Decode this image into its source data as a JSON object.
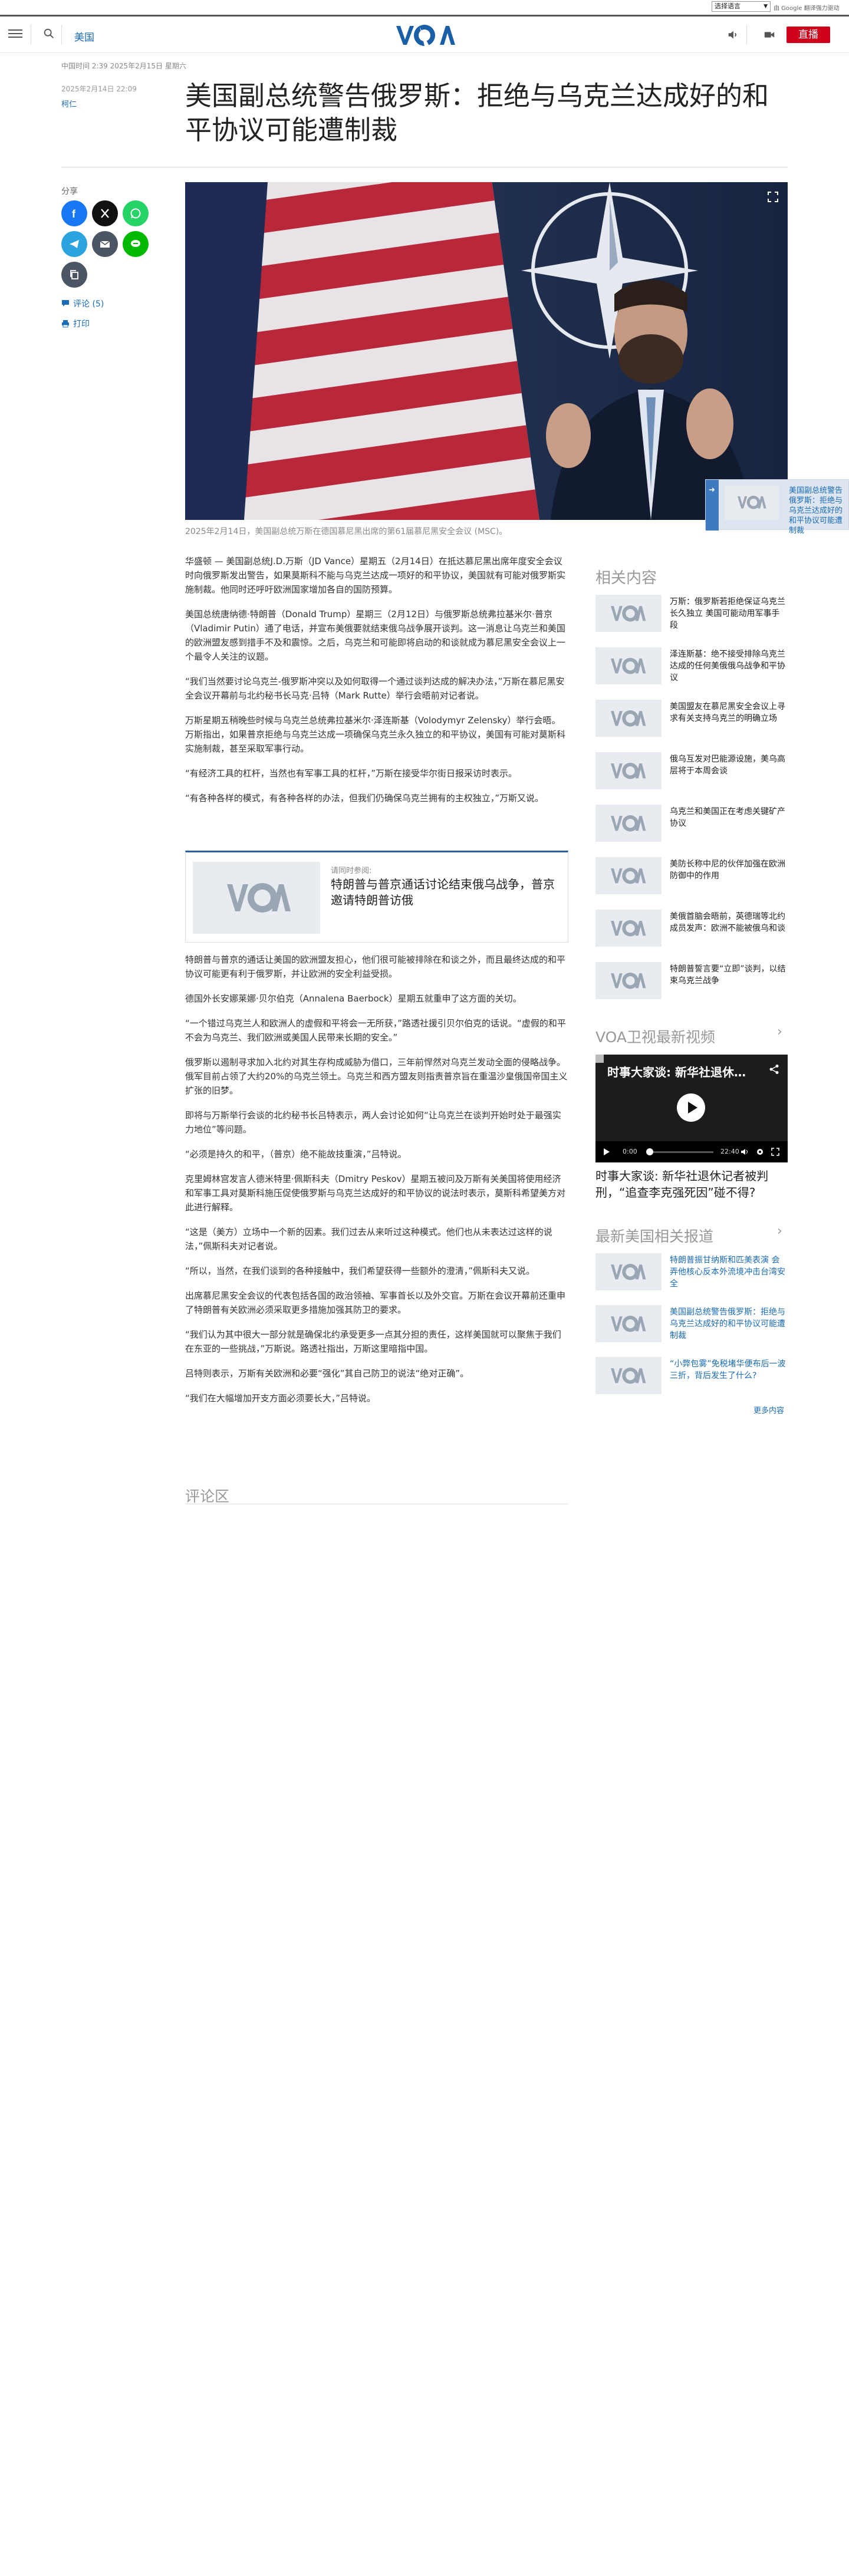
{
  "translate_bar": {
    "select_label": "选择语言",
    "powered_by": "由 Google 翻译强力驱动"
  },
  "header": {
    "section": "美国",
    "live_label": "直播",
    "logo_text": "VOA"
  },
  "article": {
    "dateline": "中国时间 2:39 2025年2月15日 星期六",
    "published": "2025年2月14日 22:09",
    "author": "柯仁",
    "title": "美国副总统警告俄罗斯：拒绝与乌克兰达成好的和平协议可能遭制裁",
    "caption": "2025年2月14日，美国副总统万斯在德国慕尼黑出席的第61届慕尼黑安全会议 (MSC)。",
    "share_label": "分享",
    "comments_label": "评论 (5)",
    "print_label": "打印",
    "paragraphs_top": [
      "华盛顿 — 美国副总统J.D.万斯（JD Vance）星期五（2月14日）在抵达慕尼黑出席年度安全会议时向俄罗斯发出警告，如果莫斯科不能与乌克兰达成一项好的和平协议，美国就有可能对俄罗斯实施制裁。他同时还呼吁欧洲国家增加各自的国防预算。",
      "美国总统唐纳德·特朗普（Donald Trump）星期三（2月12日）与俄罗斯总统弗拉基米尔·普京（Vladimir Putin）通了电话，并宣布美俄要就结束俄乌战争展开谈判。这一消息让乌克兰和美国的欧洲盟友感到措手不及和震惊。之后，乌克兰和可能即将启动的和谈就成为慕尼黑安全会议上一个最令人关注的议题。",
      "“我们当然要讨论乌克兰-俄罗斯冲突以及如何取得一个通过谈判达成的解决办法，”万斯在慕尼黑安全会议开幕前与北约秘书长马克·吕特（Mark Rutte）举行会晤前对记者说。",
      "万斯星期五稍晚些时候与乌克兰总统弗拉基米尔·泽连斯基（Volodymyr Zelensky）举行会晤。万斯指出，如果普京拒绝与乌克兰达成一项确保乌克兰永久独立的和平协议，美国有可能对莫斯科实施制裁，甚至采取军事行动。",
      "“有经济工具的杠杆，当然也有军事工具的杠杆，”万斯在接受华尔街日报采访时表示。",
      "“有各种各样的模式，有各种各样的办法，但我们仍确保乌克兰拥有的主权独立，”万斯又说。"
    ],
    "related": {
      "kicker": "请同时参阅:",
      "title": "特朗普与普京通话讨论结束俄乌战争，普京邀请特朗普访俄"
    },
    "paragraphs_bottom": [
      "特朗普与普京的通话让美国的欧洲盟友担心，他们很可能被排除在和谈之外，而且最终达成的和平协议可能更有利于俄罗斯，并让欧洲的安全利益受损。",
      "德国外长安娜莱娜·贝尔伯克（Annalena Baerbock）星期五就重申了这方面的关切。",
      "“一个错过乌克兰人和欧洲人的虚假和平将会一无所获，”路透社援引贝尔伯克的话说。“虚假的和平不会为乌克兰、我们欧洲或美国人民带来长期的安全。”",
      "俄罗斯以遏制寻求加入北约对其生存构成威胁为借口，三年前悍然对乌克兰发动全面的侵略战争。俄军目前占领了大约20%的乌克兰领土。乌克兰和西方盟友则指责普京旨在重温沙皇俄国帝国主义扩张的旧梦。",
      "即将与万斯举行会谈的北约秘书长吕特表示，两人会讨论如何“让乌克兰在谈判开始时处于最强实力地位”等问题。",
      "“必须是持久的和平，（普京）绝不能故技重演，”吕特说。",
      "克里姆林宫发言人德米特里·佩斯科夫（Dmitry Peskov）星期五被问及万斯有关美国将使用经济和军事工具对莫斯科施压促使俄罗斯与乌克兰达成好的和平协议的说法时表示，莫斯科希望美方对此进行解释。",
      "“这是（美方）立场中一个新的因素。我们过去从来听过这种模式。他们也从未表达过这样的说法，”佩斯科夫对记者说。",
      "“所以，当然，在我们谈到的各种接触中，我们希望获得一些额外的澄清，”佩斯科夫又说。",
      "出席慕尼黑安全会议的代表包括各国的政治领袖、军事首长以及外交官。万斯在会议开幕前还重申了特朗普有关欧洲必须采取更多措施加强其防卫的要求。",
      "“我们认为其中很大一部分就是确保北约承受更多一点其分担的责任，这样美国就可以聚焦于我们在东亚的一些挑战，”万斯说。路透社指出，万斯这里暗指中国。",
      "吕特则表示，万斯有关欧洲和必要“强化”其自己防卫的说法“绝对正确”。",
      "“我们在大幅增加开支方面必须要长大，”吕特说。"
    ],
    "comments_heading": "评论区"
  },
  "rail": {
    "related_heading": "相关内容",
    "related_items": [
      "万斯：俄罗斯若拒绝保证乌克兰长久独立 美国可能动用军事手段",
      "泽连斯基：绝不接受排除乌克兰达成的任何美俄俄乌战争和平协议",
      "美国盟友在慕尼黑安全会议上寻求有关支持乌克兰的明确立场",
      "俄乌互发对巴能源设施，美乌高层将于本周会谈",
      "乌克兰和美国正在考虑关键矿产协议",
      "美防长称中尼的伙伴加强在欧洲防御中的作用",
      "美俄首脑会晤前，英德瑞等北约成员发声：欧洲不能被俄乌和谈",
      "特朗普誓言要“立即”谈判，以结束乌克兰战争"
    ],
    "video_heading": "VOA卫视最新视频",
    "video": {
      "overlay_title": "时事大家谈: 新华社退休记...",
      "time_current": "0:00",
      "time_total": "22:40",
      "progress_fraction": 0.0,
      "caption": "时事大家谈: 新华社退休记者被判刑，“追查李克强死因”碰不得?"
    },
    "latest_heading": "最新美国相关报道",
    "latest_items": [
      "特朗普振甘纳斯和匹美表演 会弄他核心反本外流境冲击台湾安全",
      "美国副总统警告俄罗斯：拒绝与乌克兰达成好的和平协议可能遭制裁",
      "“小弊包雾”免税堵华便布后一波三折，背后发生了什么?"
    ],
    "more_label": "更多内容"
  },
  "floating": {
    "text": "美国副总统警告俄罗斯：拒绝与乌克兰达成好的和平协议可能遭制裁"
  },
  "colors": {
    "accent": "#1a6bb8",
    "live": "#d0021b",
    "logo_blue": "#1a5ea8",
    "facebook": "#1877f2",
    "x": "#111111",
    "whatsapp": "#25d366",
    "telegram": "#2aa3df",
    "email": "#4b5563",
    "line": "#00b900",
    "copy": "#4b5563"
  }
}
